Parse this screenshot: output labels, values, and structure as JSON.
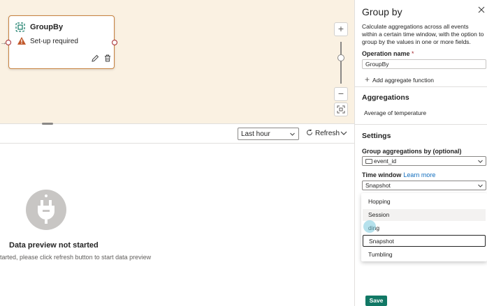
{
  "node": {
    "title": "GroupBy",
    "status": "Set-up required"
  },
  "zoom": {
    "in": "+",
    "out": "−"
  },
  "preview": {
    "time_range": "Last hour",
    "refresh_label": "Refresh",
    "empty_title": "Data preview not started",
    "empty_desc": "tarted, please click refresh button to start data preview"
  },
  "panel": {
    "title": "Group by",
    "description": "Calculate aggregations across all events within a certain time window, with the option to group by the values in one or more fields.",
    "operation_name_label": "Operation name",
    "required_mark": "*",
    "operation_name_value": "GroupBy",
    "add_fn_label": "Add aggregate function",
    "aggregations_title": "Aggregations",
    "aggregation_item": "Average of temperature",
    "settings_title": "Settings",
    "group_label": "Group aggregations by (optional)",
    "group_value": "event_id",
    "time_window_label": "Time window",
    "learn_more": "Learn more",
    "time_window_value": "Snapshot",
    "options": [
      "Hopping",
      "Session",
      "ding",
      "Snapshot",
      "Tumbling"
    ],
    "save_label": "Save"
  },
  "colors": {
    "accent": "#117865",
    "canvas": "#faf1e2",
    "node_border": "#c7823f",
    "link": "#0f6cbd"
  }
}
